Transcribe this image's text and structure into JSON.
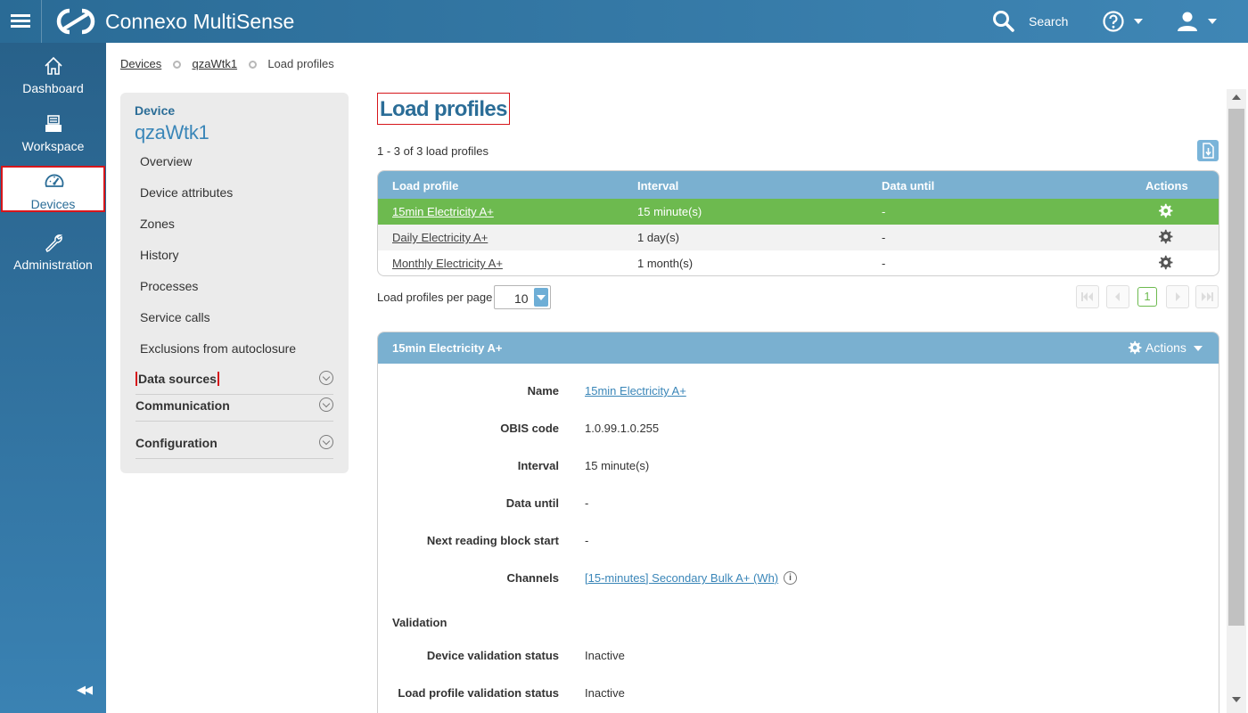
{
  "app": {
    "title": "Connexo MultiSense",
    "search_label": "Search"
  },
  "nav": {
    "items": [
      {
        "label": "Dashboard",
        "icon": "home-icon"
      },
      {
        "label": "Workspace",
        "icon": "inbox-icon"
      },
      {
        "label": "Devices",
        "icon": "gauge-icon",
        "active": true
      },
      {
        "label": "Administration",
        "icon": "wrench-icon"
      }
    ],
    "collapse_label": "◀◀"
  },
  "breadcrumb": {
    "items": [
      "Devices",
      "qzaWtk1",
      "Load profiles"
    ]
  },
  "sidepanel": {
    "caption": "Device",
    "device_name": "qzaWtk1",
    "links": [
      "Overview",
      "Device attributes",
      "Zones",
      "History",
      "Processes",
      "Service calls",
      "Exclusions from autoclosure"
    ],
    "sections": [
      "Data sources",
      "Communication",
      "Configuration"
    ]
  },
  "main": {
    "title": "Load profiles",
    "count_text": "1 - 3 of 3 load profiles",
    "grid": {
      "columns": [
        "Load profile",
        "Interval",
        "Data until",
        "Actions"
      ],
      "rows": [
        {
          "name": "15min Electricity A+",
          "interval": "15 minute(s)",
          "data_until": "-"
        },
        {
          "name": "Daily Electricity A+",
          "interval": "1 day(s)",
          "data_until": "-"
        },
        {
          "name": "Monthly Electricity A+",
          "interval": "1 month(s)",
          "data_until": "-"
        }
      ]
    },
    "pagination": {
      "per_page_label": "Load profiles per page",
      "per_page_value": "10",
      "current_page": "1"
    }
  },
  "detail": {
    "title": "15min Electricity A+",
    "actions_label": "Actions",
    "fields": {
      "name_label": "Name",
      "name_value": "15min Electricity A+",
      "obis_label": "OBIS code",
      "obis_value": "1.0.99.1.0.255",
      "interval_label": "Interval",
      "interval_value": "15 minute(s)",
      "data_until_label": "Data until",
      "data_until_value": "-",
      "next_block_label": "Next reading block start",
      "next_block_value": "-",
      "channels_label": "Channels",
      "channels_value": "[15-minutes] Secondary Bulk A+ (Wh)"
    },
    "validation": {
      "heading": "Validation",
      "device_status_label": "Device validation status",
      "device_status_value": "Inactive",
      "profile_status_label": "Load profile validation status",
      "profile_status_value": "Inactive"
    }
  },
  "colors": {
    "topbar": "#2a6b96",
    "accent": "#2b6d97",
    "grid_header": "#7ab0d0",
    "selected_row": "#6dba4f",
    "highlight_outline": "#d6161b"
  }
}
